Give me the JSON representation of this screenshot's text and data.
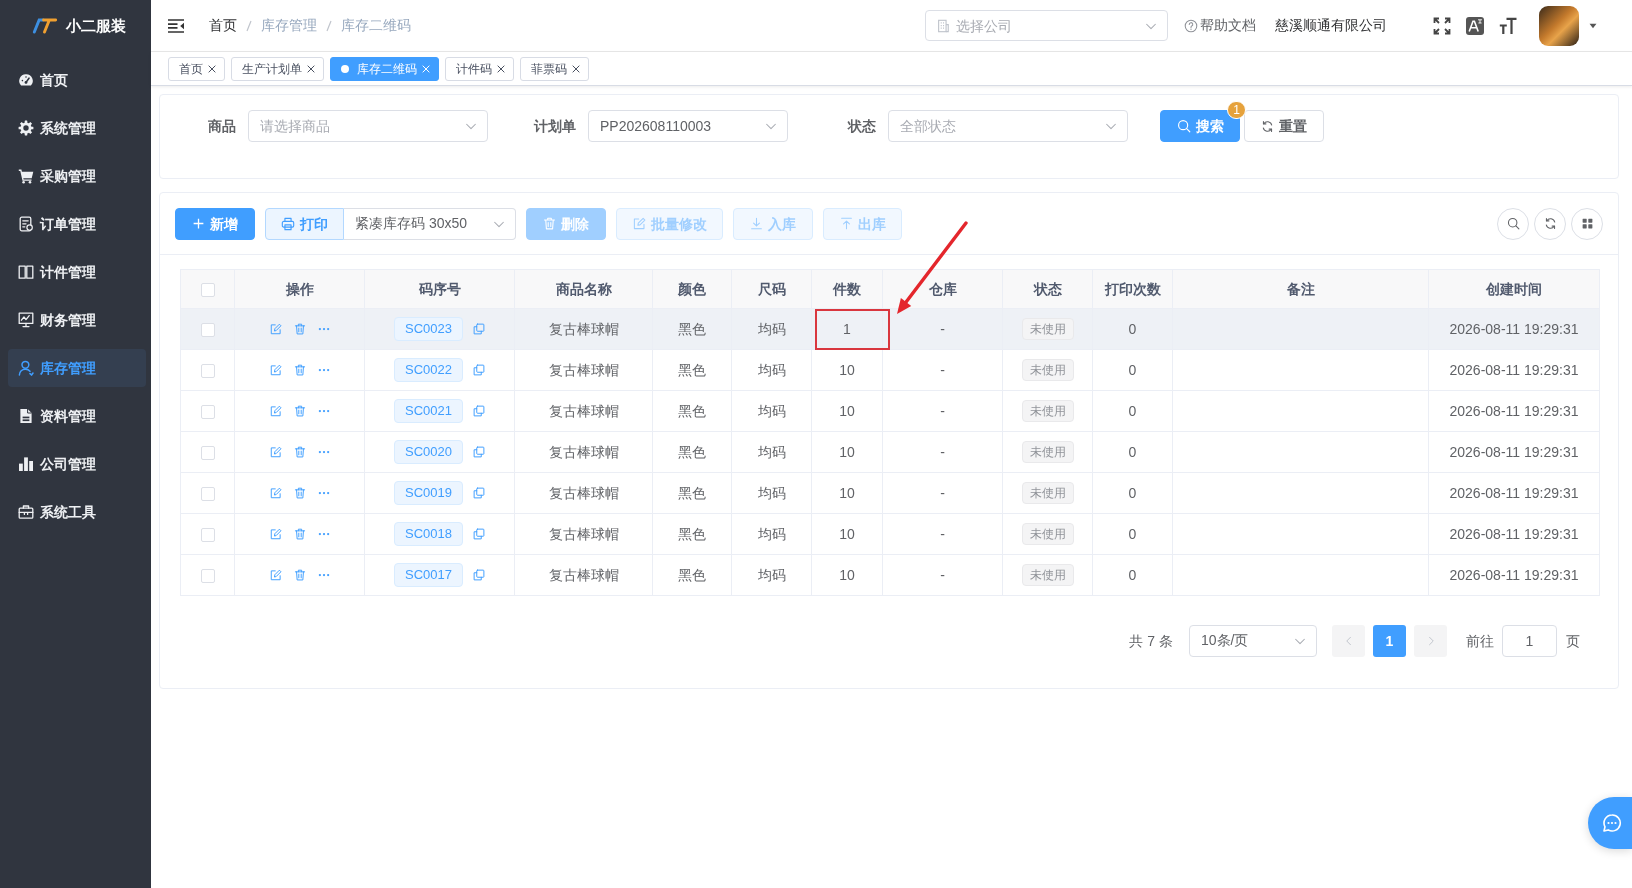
{
  "sidebar": {
    "logo": "小二服装",
    "items": [
      {
        "label": "首页",
        "selected": false
      },
      {
        "label": "系统管理",
        "selected": false
      },
      {
        "label": "采购管理",
        "selected": false
      },
      {
        "label": "订单管理",
        "selected": false
      },
      {
        "label": "计件管理",
        "selected": false
      },
      {
        "label": "财务管理",
        "selected": false
      },
      {
        "label": "库存管理",
        "selected": true
      },
      {
        "label": "资料管理",
        "selected": false
      },
      {
        "label": "公司管理",
        "selected": false
      },
      {
        "label": "系统工具",
        "selected": false
      }
    ]
  },
  "header": {
    "breadcrumb": [
      {
        "label": "首页",
        "link": true
      },
      {
        "label": "库存管理",
        "link": false
      },
      {
        "label": "库存二维码",
        "link": false
      }
    ],
    "company_select": {
      "placeholder": "选择公司"
    },
    "help": "帮助文档",
    "company_name": "慈溪顺通有限公司"
  },
  "tabs": [
    {
      "label": "首页",
      "selected": false
    },
    {
      "label": "生产计划单",
      "selected": false
    },
    {
      "label": "库存二维码",
      "selected": true
    },
    {
      "label": "计件码",
      "selected": false
    },
    {
      "label": "菲票码",
      "selected": false
    }
  ],
  "filters": {
    "fields": [
      {
        "label": "商品",
        "placeholder": "请选择商品"
      },
      {
        "label": "计划单",
        "value": "PP202608110003"
      },
      {
        "label": "状态",
        "placeholder": "全部状态"
      }
    ],
    "search": {
      "label": "搜索",
      "badge": "1"
    },
    "reset": "重置"
  },
  "toolbar": {
    "add": "新增",
    "print": {
      "label": "打印",
      "template": "紧凑库存码 30x50"
    },
    "actions": [
      {
        "label": "删除",
        "kind": "solid",
        "disabled": true
      },
      {
        "label": "批量修改",
        "kind": "plain",
        "disabled": true
      },
      {
        "label": "入库",
        "kind": "plain",
        "disabled": true
      },
      {
        "label": "出库",
        "kind": "plain",
        "disabled": true
      }
    ]
  },
  "table": {
    "all_checked": false,
    "columns": [
      "操作",
      "码序号",
      "商品名称",
      "颜色",
      "尺码",
      "件数",
      "仓库",
      "状态",
      "打印次数",
      "备注",
      "创建时间"
    ],
    "rows": [
      {
        "checked": false,
        "hovered": true,
        "highlighted": true,
        "code": "SC0023",
        "product": "复古棒球帽",
        "color_name": "黑色",
        "size": "均码",
        "quantity": "1",
        "warehouse": "-",
        "status": "未使用",
        "print_count": "0",
        "created": "2026-08-11 19:29:31"
      },
      {
        "checked": false,
        "hovered": false,
        "highlighted": false,
        "code": "SC0022",
        "product": "复古棒球帽",
        "color_name": "黑色",
        "size": "均码",
        "quantity": "10",
        "warehouse": "-",
        "status": "未使用",
        "print_count": "0",
        "created": "2026-08-11 19:29:31"
      },
      {
        "checked": false,
        "hovered": false,
        "highlighted": false,
        "code": "SC0021",
        "product": "复古棒球帽",
        "color_name": "黑色",
        "size": "均码",
        "quantity": "10",
        "warehouse": "-",
        "status": "未使用",
        "print_count": "0",
        "created": "2026-08-11 19:29:31"
      },
      {
        "checked": false,
        "hovered": false,
        "highlighted": false,
        "code": "SC0020",
        "product": "复古棒球帽",
        "color_name": "黑色",
        "size": "均码",
        "quantity": "10",
        "warehouse": "-",
        "status": "未使用",
        "print_count": "0",
        "created": "2026-08-11 19:29:31"
      },
      {
        "checked": false,
        "hovered": false,
        "highlighted": false,
        "code": "SC0019",
        "product": "复古棒球帽",
        "color_name": "黑色",
        "size": "均码",
        "quantity": "10",
        "warehouse": "-",
        "status": "未使用",
        "print_count": "0",
        "created": "2026-08-11 19:29:31"
      },
      {
        "checked": false,
        "hovered": false,
        "highlighted": false,
        "code": "SC0018",
        "product": "复古棒球帽",
        "color_name": "黑色",
        "size": "均码",
        "quantity": "10",
        "warehouse": "-",
        "status": "未使用",
        "print_count": "0",
        "created": "2026-08-11 19:29:31"
      },
      {
        "checked": false,
        "hovered": false,
        "highlighted": false,
        "code": "SC0017",
        "product": "复古棒球帽",
        "color_name": "黑色",
        "size": "均码",
        "quantity": "10",
        "warehouse": "-",
        "status": "未使用",
        "print_count": "0",
        "created": "2026-08-11 19:29:31"
      }
    ]
  },
  "pagination": {
    "total": "共 7 条",
    "page_size": "10条/页",
    "prev_disabled": true,
    "pages": [
      {
        "label": "1",
        "selected": true
      }
    ],
    "next_disabled": true,
    "goto_label": "前往",
    "goto_value": "1",
    "unit": "页"
  }
}
